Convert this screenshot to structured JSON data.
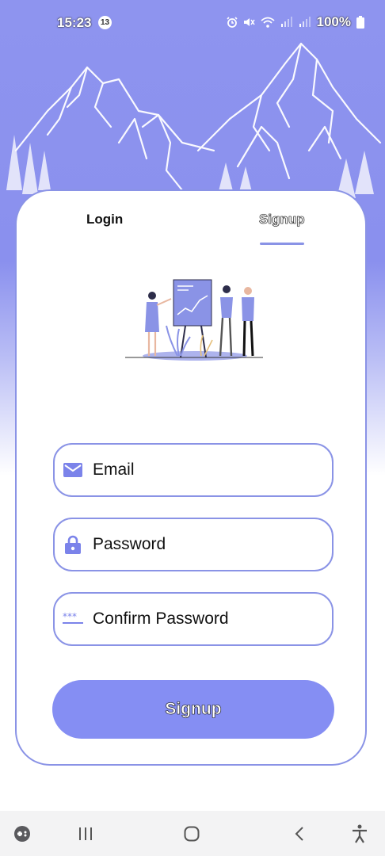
{
  "status_bar": {
    "time": "15:23",
    "notification_count": "13",
    "battery": "100%"
  },
  "tabs": {
    "login": "Login",
    "signup": "Signup",
    "active": "signup"
  },
  "form": {
    "email": {
      "placeholder": "Email",
      "value": ""
    },
    "password": {
      "placeholder": "Password",
      "value": ""
    },
    "confirm_password": {
      "placeholder": "Confirm Password",
      "value": ""
    },
    "submit_label": "Signup"
  },
  "icons": {
    "email": "mail-icon",
    "password": "lock-icon",
    "confirm_password": "password-dots-icon",
    "nav": [
      "game-launcher-icon",
      "recent-apps-icon",
      "home-icon",
      "back-icon",
      "accessibility-icon"
    ]
  },
  "colors": {
    "accent": "#8a93e6",
    "button": "#858ef3",
    "background_top": "#8e94ef"
  }
}
